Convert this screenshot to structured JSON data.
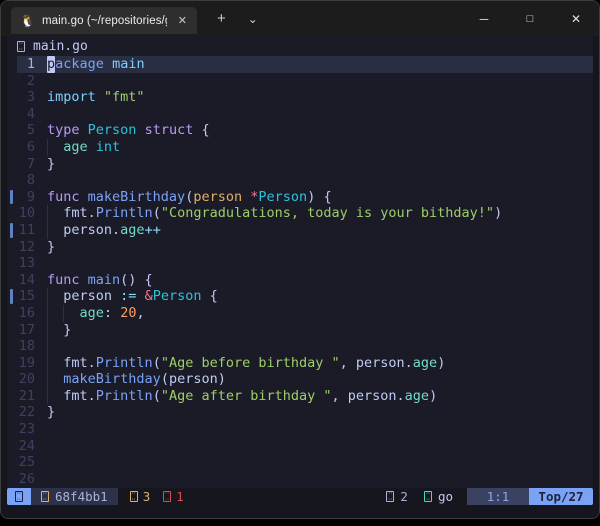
{
  "window": {
    "tab_icon": "🐧",
    "tab_title": "main.go (~/repositories/go-st",
    "tab_close": "✕",
    "new_tab": "+",
    "dropdown": "⌄",
    "minimize": "─",
    "maximize": "□",
    "close": "✕"
  },
  "palette": {
    "fg": "#c0caf5",
    "blue": "#7aa2f7",
    "cyan": "#7dcfff",
    "teal": "#2ac3de",
    "field": "#73daca",
    "string": "#9ece6a",
    "keyword": "#bb9af7",
    "number": "#ff9e64",
    "param": "#e0af68",
    "red": "#f7768e",
    "op": "#89ddff",
    "git_sign": "#5d81c1",
    "cursorline": "#292e42",
    "bg": "#1a1b26",
    "statusline_accent": "#7aa2f7"
  },
  "editor": {
    "winbar_title": "main.go",
    "lines": [
      {
        "n": 1,
        "cursorline": true,
        "tokens": [
          {
            "t": "p",
            "c": "blue",
            "cursor": true
          },
          {
            "t": "ackage",
            "c": "blue"
          },
          {
            "t": " "
          },
          {
            "t": "main",
            "c": "cyan"
          }
        ]
      },
      {
        "n": 2,
        "tokens": []
      },
      {
        "n": 3,
        "tokens": [
          {
            "t": "import",
            "c": "cyan"
          },
          {
            "t": " "
          },
          {
            "t": "\"fmt\"",
            "c": "string"
          }
        ]
      },
      {
        "n": 4,
        "tokens": []
      },
      {
        "n": 5,
        "tokens": [
          {
            "t": "type",
            "c": "keyword"
          },
          {
            "t": " "
          },
          {
            "t": "Person",
            "c": "teal"
          },
          {
            "t": " "
          },
          {
            "t": "struct",
            "c": "keyword"
          },
          {
            "t": " {",
            "c": "fg"
          }
        ]
      },
      {
        "n": 6,
        "tokens": [
          {
            "g": true
          },
          {
            "t": " "
          },
          {
            "t": "age",
            "c": "field"
          },
          {
            "t": " "
          },
          {
            "t": "int",
            "c": "teal"
          }
        ]
      },
      {
        "n": 7,
        "tokens": [
          {
            "t": "}",
            "c": "fg"
          }
        ]
      },
      {
        "n": 8,
        "tokens": []
      },
      {
        "n": 9,
        "sign": true,
        "tokens": [
          {
            "t": "func",
            "c": "keyword"
          },
          {
            "t": " "
          },
          {
            "t": "makeBirthday",
            "c": "blue"
          },
          {
            "t": "(",
            "c": "fg"
          },
          {
            "t": "person",
            "c": "param"
          },
          {
            "t": " "
          },
          {
            "t": "*",
            "c": "red"
          },
          {
            "t": "Person",
            "c": "teal"
          },
          {
            "t": ") {",
            "c": "fg"
          }
        ]
      },
      {
        "n": 10,
        "tokens": [
          {
            "g": true
          },
          {
            "t": " "
          },
          {
            "t": "fmt.",
            "c": "fg"
          },
          {
            "t": "Println",
            "c": "blue"
          },
          {
            "t": "(",
            "c": "fg"
          },
          {
            "t": "\"Congradulations, today is your bithday!\"",
            "c": "string"
          },
          {
            "t": ")",
            "c": "fg"
          }
        ]
      },
      {
        "n": 11,
        "sign": true,
        "tokens": [
          {
            "g": true
          },
          {
            "t": " "
          },
          {
            "t": "person.",
            "c": "fg"
          },
          {
            "t": "age",
            "c": "field"
          },
          {
            "t": "++",
            "c": "op"
          }
        ]
      },
      {
        "n": 12,
        "tokens": [
          {
            "t": "}",
            "c": "fg"
          }
        ]
      },
      {
        "n": 13,
        "tokens": []
      },
      {
        "n": 14,
        "tokens": [
          {
            "t": "func",
            "c": "keyword"
          },
          {
            "t": " "
          },
          {
            "t": "main",
            "c": "blue"
          },
          {
            "t": "() {",
            "c": "fg"
          }
        ]
      },
      {
        "n": 15,
        "sign": true,
        "tokens": [
          {
            "g": true
          },
          {
            "t": " "
          },
          {
            "t": "person ",
            "c": "fg"
          },
          {
            "t": ":=",
            "c": "op"
          },
          {
            "t": " "
          },
          {
            "t": "&",
            "c": "red"
          },
          {
            "t": "Person",
            "c": "teal"
          },
          {
            "t": " {",
            "c": "fg"
          }
        ]
      },
      {
        "n": 16,
        "tokens": [
          {
            "g": true
          },
          {
            "t": " "
          },
          {
            "g": true
          },
          {
            "t": " "
          },
          {
            "t": "age",
            "c": "field"
          },
          {
            "t": ":",
            "c": "fg"
          },
          {
            "t": " "
          },
          {
            "t": "20",
            "c": "number"
          },
          {
            "t": ",",
            "c": "fg"
          }
        ]
      },
      {
        "n": 17,
        "tokens": [
          {
            "g": true
          },
          {
            "t": " "
          },
          {
            "t": "}",
            "c": "fg"
          }
        ]
      },
      {
        "n": 18,
        "tokens": [
          {
            "g": true
          }
        ]
      },
      {
        "n": 19,
        "tokens": [
          {
            "g": true
          },
          {
            "t": " "
          },
          {
            "t": "fmt.",
            "c": "fg"
          },
          {
            "t": "Println",
            "c": "blue"
          },
          {
            "t": "(",
            "c": "fg"
          },
          {
            "t": "\"Age before birthday \"",
            "c": "string"
          },
          {
            "t": ", person.",
            "c": "fg"
          },
          {
            "t": "age",
            "c": "field"
          },
          {
            "t": ")",
            "c": "fg"
          }
        ]
      },
      {
        "n": 20,
        "tokens": [
          {
            "g": true
          },
          {
            "t": " "
          },
          {
            "t": "makeBirthday",
            "c": "blue"
          },
          {
            "t": "(person)",
            "c": "fg"
          }
        ]
      },
      {
        "n": 21,
        "tokens": [
          {
            "g": true
          },
          {
            "t": " "
          },
          {
            "t": "fmt.",
            "c": "fg"
          },
          {
            "t": "Println",
            "c": "blue"
          },
          {
            "t": "(",
            "c": "fg"
          },
          {
            "t": "\"Age after birthday \"",
            "c": "string"
          },
          {
            "t": ", person.",
            "c": "fg"
          },
          {
            "t": "age",
            "c": "field"
          },
          {
            "t": ")",
            "c": "fg"
          }
        ]
      },
      {
        "n": 22,
        "tokens": [
          {
            "t": "}",
            "c": "fg"
          }
        ]
      },
      {
        "n": 23,
        "tokens": []
      },
      {
        "n": 24,
        "tokens": []
      },
      {
        "n": 25,
        "tokens": []
      },
      {
        "n": 26,
        "tokens": []
      }
    ]
  },
  "statusline": {
    "git_commit": "68f4bb1",
    "warning_count": "3",
    "error_count": "1",
    "buffer_count": "2",
    "filetype": "go",
    "cursor_position": "1:1",
    "scroll_position": "Top/27"
  }
}
